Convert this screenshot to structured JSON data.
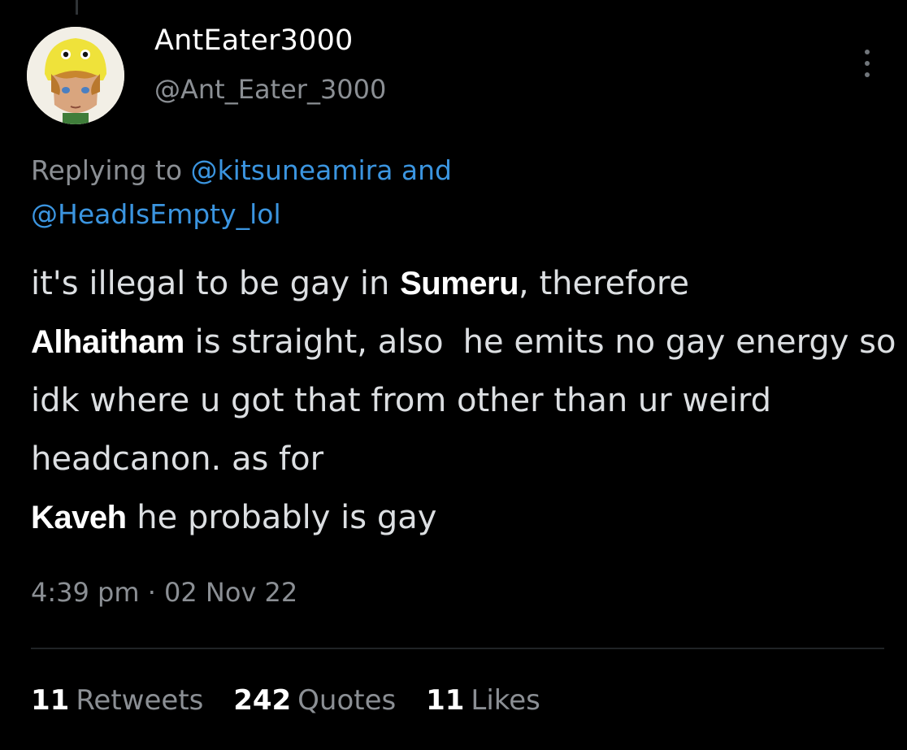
{
  "tweet": {
    "author": {
      "display_name": "AntEater3000",
      "handle": "@Ant_Eater_3000",
      "avatar_icon": "yellow-hat-elf-avatar"
    },
    "reply_context": {
      "prefix": "Replying to ",
      "mention_1": "@kitsuneamira",
      "conjunction": " and",
      "mention_2": "@HeadIsEmpty_lol"
    },
    "body": {
      "part_1": "it's illegal to be gay in ",
      "name_1": "Sumeru",
      "part_2": ", therefore",
      "name_2": "Alhaitham",
      "part_3": " is straight, also",
      "part_4": "he emits no gay energy so idk where u got that from other than ur weird headcanon. as for",
      "name_3": "Kaveh",
      "part_5": " he probably is gay"
    },
    "timestamp": "4:39 pm · 02 Nov 22",
    "stats": {
      "retweets_count": "11",
      "retweets_label": "Retweets",
      "quotes_count": "242",
      "quotes_label": "Quotes",
      "likes_count": "11",
      "likes_label": "Likes"
    },
    "more_icon": "vertical-ellipsis-icon"
  },
  "colors": {
    "background": "#000000",
    "text_primary": "#ffffff",
    "text_secondary": "#8b8f94",
    "link": "#3b95e0",
    "divider": "#202326"
  }
}
